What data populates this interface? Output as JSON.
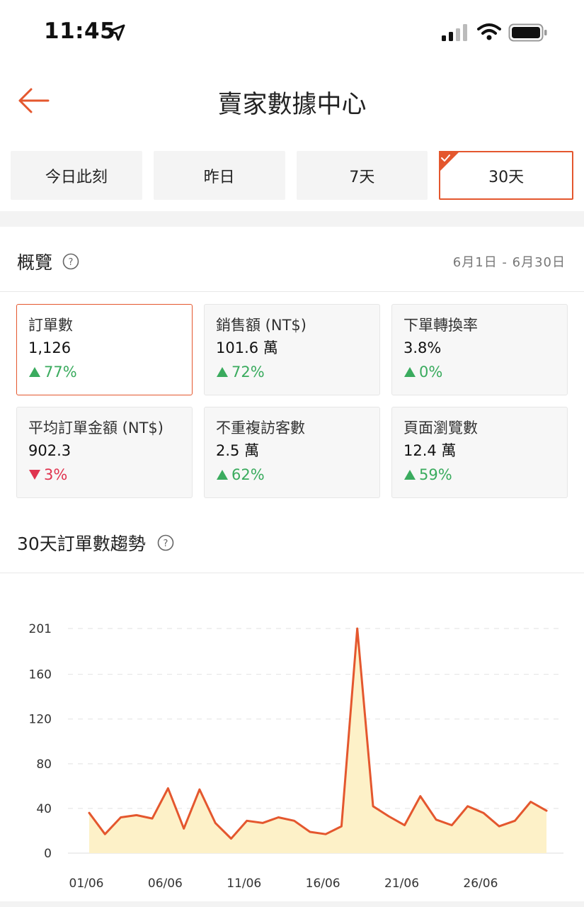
{
  "status_bar": {
    "time": "11:45"
  },
  "nav": {
    "title": "賣家數據中心"
  },
  "tabs": [
    {
      "label": "今日此刻",
      "active": false
    },
    {
      "label": "昨日",
      "active": false
    },
    {
      "label": "7天",
      "active": false
    },
    {
      "label": "30天",
      "active": true
    }
  ],
  "overview": {
    "title": "概覽",
    "date_range": "6月1日 - 6月30日",
    "metrics": [
      {
        "label": "訂單數",
        "value": "1,126",
        "change": "77%",
        "direction": "up",
        "active": true
      },
      {
        "label": "銷售額 (NT$)",
        "value": "101.6 萬",
        "change": "72%",
        "direction": "up",
        "active": false
      },
      {
        "label": "下單轉換率",
        "value": "3.8%",
        "change": "0%",
        "direction": "up",
        "active": false
      },
      {
        "label": "平均訂單金額 (NT$)",
        "value": "902.3",
        "change": "3%",
        "direction": "down",
        "active": false
      },
      {
        "label": "不重複訪客數",
        "value": "2.5 萬",
        "change": "62%",
        "direction": "up",
        "active": false
      },
      {
        "label": "頁面瀏覽數",
        "value": "12.4 萬",
        "change": "59%",
        "direction": "up",
        "active": false
      }
    ]
  },
  "trend": {
    "title": "30天訂單數趨勢"
  },
  "colors": {
    "accent": "#e4572e",
    "up": "#3aab5e",
    "down": "#e0344f",
    "area_fill": "#fdf1c8",
    "line": "#e4572e"
  },
  "chart_data": {
    "type": "area",
    "x": [
      "01/06",
      "02/06",
      "03/06",
      "04/06",
      "05/06",
      "06/06",
      "07/06",
      "08/06",
      "09/06",
      "10/06",
      "11/06",
      "12/06",
      "13/06",
      "14/06",
      "15/06",
      "16/06",
      "17/06",
      "18/06",
      "19/06",
      "20/06",
      "21/06",
      "22/06",
      "23/06",
      "24/06",
      "25/06",
      "26/06",
      "27/06",
      "28/06",
      "29/06",
      "30/06"
    ],
    "xticks": [
      "01/06",
      "06/06",
      "11/06",
      "16/06",
      "21/06",
      "26/06"
    ],
    "series": [
      {
        "values": [
          36,
          17,
          32,
          34,
          31,
          58,
          22,
          57,
          27,
          13,
          29,
          27,
          32,
          29,
          19,
          17,
          24,
          201,
          42,
          33,
          25,
          51,
          30,
          25,
          42,
          36,
          24,
          29,
          46,
          38
        ]
      }
    ],
    "yticks": [
      0,
      40,
      80,
      120,
      160,
      201
    ],
    "ylim": [
      0,
      201
    ],
    "xlabel": "",
    "ylabel": "",
    "title": "",
    "grid": true,
    "legend": false
  }
}
